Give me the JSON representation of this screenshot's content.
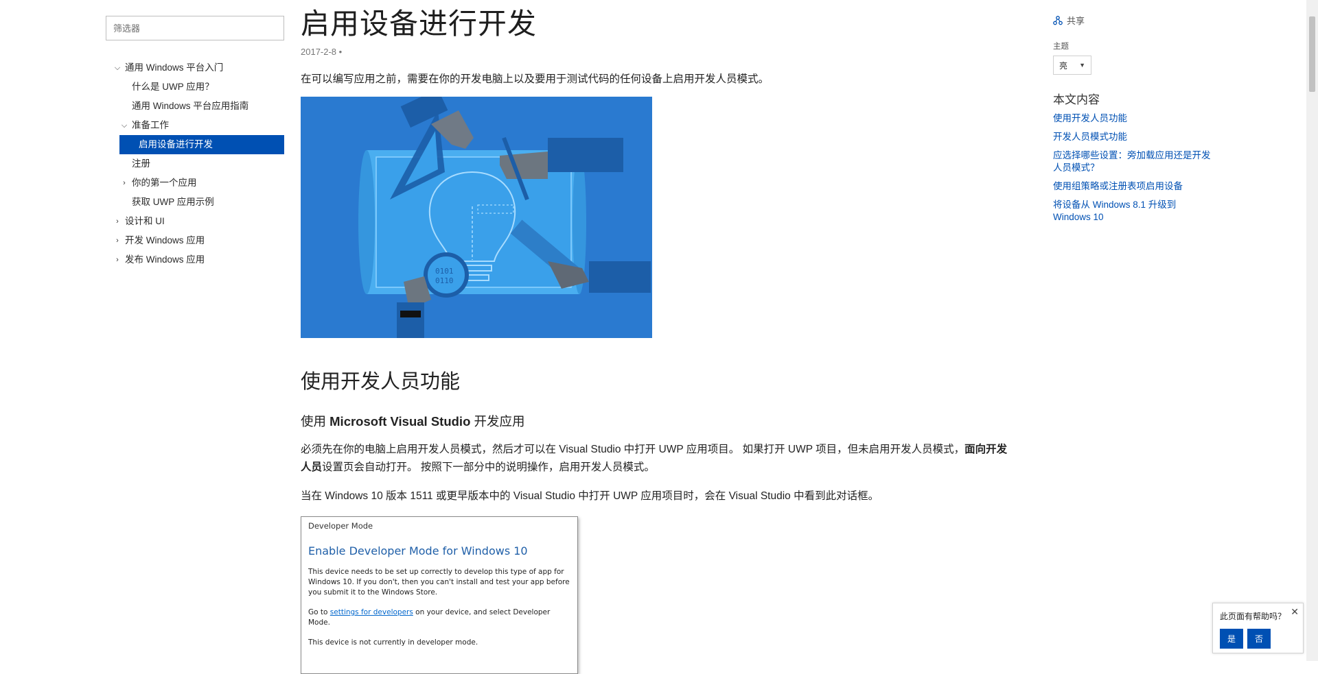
{
  "filter": {
    "placeholder": "筛选器"
  },
  "nav": {
    "items": [
      {
        "label": "通用 Windows 平台入门",
        "chevron": "v"
      },
      {
        "label": "什么是 UWP 应用？"
      },
      {
        "label": "通用 Windows 平台应用指南"
      },
      {
        "label": "准备工作",
        "chevron": "v"
      },
      {
        "label": "启用设备进行开发",
        "active": true
      },
      {
        "label": "注册"
      },
      {
        "label": "你的第一个应用",
        "chevron": ">"
      },
      {
        "label": "获取 UWP 应用示例"
      },
      {
        "label": "设计和 UI",
        "chevron": ">"
      },
      {
        "label": "开发 Windows 应用",
        "chevron": ">"
      },
      {
        "label": "发布 Windows 应用",
        "chevron": ">"
      }
    ]
  },
  "article": {
    "title": "启用设备进行开发",
    "date": "2017-2-8",
    "date_sep": "•",
    "intro": "在可以编写应用之前，需要在你的开发电脑上以及要用于测试代码的任何设备上启用开发人员模式。",
    "h2": "使用开发人员功能",
    "h3_prefix": "使用 ",
    "h3_bold": "Microsoft Visual Studio",
    "h3_suffix": " 开发应用",
    "para1_a": "必须先在你的电脑上启用开发人员模式，然后才可以在 Visual Studio 中打开 UWP 应用项目。 如果打开 UWP 项目，但未启用开发人员模式，",
    "para1_bold": "面向开发人员",
    "para1_b": "设置页会自动打开。 按照下一部分中的说明操作，启用开发人员模式。",
    "para2": "当在 Windows 10 版本 1511 或更早版本中的 Visual Studio 中打开 UWP 应用项目时，会在 Visual Studio 中看到此对话框。"
  },
  "dialog": {
    "caption": "Developer Mode",
    "title": "Enable Developer Mode for Windows 10",
    "text1": "This device needs to be set up correctly to develop this type of app for Windows 10. If you don't, then you can't install and test your app before you submit it to the Windows Store.",
    "text2_a": "Go to ",
    "text2_link": "settings for developers",
    "text2_b": " on your device, and select Developer Mode.",
    "text3": "This device is not currently in developer mode."
  },
  "rail": {
    "share": "共享",
    "theme_label": "主题",
    "theme_value": "亮",
    "toc_title": "本文内容",
    "toc": [
      "使用开发人员功能",
      "开发人员模式功能",
      "应选择哪些设置：旁加载应用还是开发人员模式？",
      "使用组策略或注册表项启用设备",
      "将设备从 Windows 8.1 升级到 Windows 10"
    ]
  },
  "feedback": {
    "question": "此页面有帮助吗？",
    "yes": "是",
    "no": "否",
    "close": "✕"
  },
  "colors": {
    "accent": "#0050b3",
    "hero_bg": "#2a7ad0"
  }
}
